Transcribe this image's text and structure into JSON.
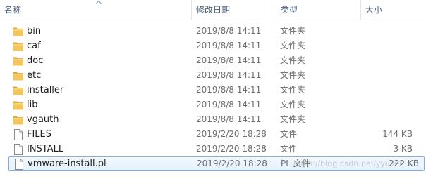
{
  "header": {
    "col_name": "名称",
    "col_date": "修改日期",
    "col_type": "类型",
    "col_size": "大小"
  },
  "files": [
    {
      "name": "bin",
      "date": "2019/8/8 14:11",
      "type": "文件夹",
      "size": "",
      "icon": "folder-icon"
    },
    {
      "name": "caf",
      "date": "2019/8/8 14:11",
      "type": "文件夹",
      "size": "",
      "icon": "folder-icon"
    },
    {
      "name": "doc",
      "date": "2019/8/8 14:11",
      "type": "文件夹",
      "size": "",
      "icon": "folder-icon"
    },
    {
      "name": "etc",
      "date": "2019/8/8 14:11",
      "type": "文件夹",
      "size": "",
      "icon": "folder-icon"
    },
    {
      "name": "installer",
      "date": "2019/8/8 14:11",
      "type": "文件夹",
      "size": "",
      "icon": "folder-icon"
    },
    {
      "name": "lib",
      "date": "2019/8/8 14:11",
      "type": "文件夹",
      "size": "",
      "icon": "folder-icon"
    },
    {
      "name": "vgauth",
      "date": "2019/8/8 14:11",
      "type": "文件夹",
      "size": "",
      "icon": "folder-icon"
    },
    {
      "name": "FILES",
      "date": "2019/2/20 18:28",
      "type": "文件",
      "size": "144 KB",
      "icon": "file-icon"
    },
    {
      "name": "INSTALL",
      "date": "2019/2/20 18:28",
      "type": "文件",
      "size": "3 KB",
      "icon": "file-icon"
    },
    {
      "name": "vmware-install.pl",
      "date": "2019/2/20 18:28",
      "type": "PL 文件",
      "size": "222 KB",
      "icon": "file-icon",
      "selected": true
    }
  ],
  "watermark": "https://blog.csdn.net/yyuser",
  "colors": {
    "folder": "#e8b74a",
    "selection_border": "#84acdd",
    "header_text": "#4c607a"
  }
}
